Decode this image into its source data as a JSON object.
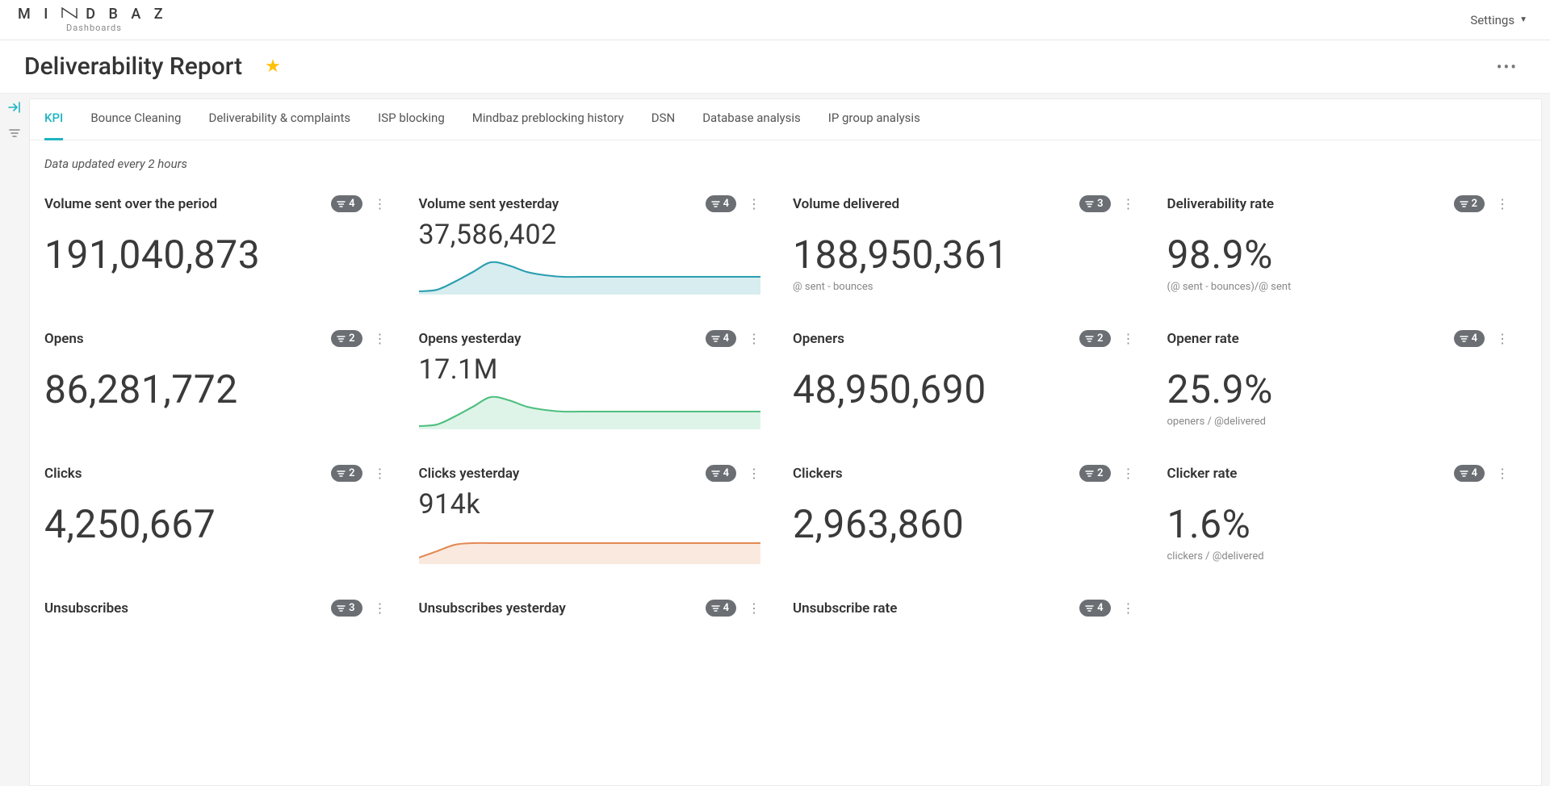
{
  "header": {
    "brand_main": "M I N D B A Z",
    "brand_sub": "Dashboards",
    "settings_label": "Settings"
  },
  "page": {
    "title": "Deliverability Report"
  },
  "tabs": [
    "KPI",
    "Bounce Cleaning",
    "Deliverability & complaints",
    "ISP blocking",
    "Mindbaz preblocking history",
    "DSN",
    "Database analysis",
    "IP group analysis"
  ],
  "note": "Data updated every 2 hours",
  "cards": {
    "r0c0": {
      "title": "Volume sent over the period",
      "pill": "4",
      "value": "191,040,873"
    },
    "r0c1": {
      "title": "Volume sent yesterday",
      "pill": "4",
      "value": "37,586,402"
    },
    "r0c2": {
      "title": "Volume delivered",
      "pill": "3",
      "value": "188,950,361",
      "sub": "@ sent - bounces"
    },
    "r0c3": {
      "title": "Deliverability rate",
      "pill": "2",
      "value": "98.9%",
      "sub": "(@ sent - bounces)/@ sent"
    },
    "r1c0": {
      "title": "Opens",
      "pill": "2",
      "value": "86,281,772"
    },
    "r1c1": {
      "title": "Opens yesterday",
      "pill": "4",
      "value": "17.1M"
    },
    "r1c2": {
      "title": "Openers",
      "pill": "2",
      "value": "48,950,690"
    },
    "r1c3": {
      "title": "Opener rate",
      "pill": "4",
      "value": "25.9%",
      "sub": "openers / @delivered"
    },
    "r2c0": {
      "title": "Clicks",
      "pill": "2",
      "value": "4,250,667"
    },
    "r2c1": {
      "title": "Clicks yesterday",
      "pill": "4",
      "value": "914k"
    },
    "r2c2": {
      "title": "Clickers",
      "pill": "2",
      "value": "2,963,860"
    },
    "r2c3": {
      "title": "Clicker rate",
      "pill": "4",
      "value": "1.6%",
      "sub": "clickers / @delivered"
    },
    "r3c0": {
      "title": "Unsubscribes",
      "pill": "3"
    },
    "r3c1": {
      "title": "Unsubscribes yesterday",
      "pill": "4"
    },
    "r3c2": {
      "title": "Unsubscribe rate",
      "pill": "4"
    }
  },
  "chart_data": [
    {
      "card": "r0c1",
      "type": "area",
      "color": "blue",
      "values": [
        2,
        3,
        8,
        14,
        20,
        18,
        14,
        12,
        11,
        11,
        11,
        11,
        11,
        11,
        11,
        11,
        11,
        11,
        11,
        11
      ],
      "ylim": [
        0,
        22
      ]
    },
    {
      "card": "r1c1",
      "type": "area",
      "color": "green",
      "values": [
        2,
        3,
        8,
        14,
        20,
        18,
        14,
        12,
        11,
        11,
        11,
        11,
        11,
        11,
        11,
        11,
        11,
        11,
        11,
        11
      ],
      "ylim": [
        0,
        22
      ]
    },
    {
      "card": "r2c1",
      "type": "area",
      "color": "orange",
      "values": [
        4,
        8,
        12,
        13,
        13,
        13,
        13,
        13,
        13,
        13,
        13,
        13,
        13,
        13,
        13,
        13,
        13,
        13,
        13,
        13
      ],
      "ylim": [
        0,
        22
      ]
    }
  ]
}
